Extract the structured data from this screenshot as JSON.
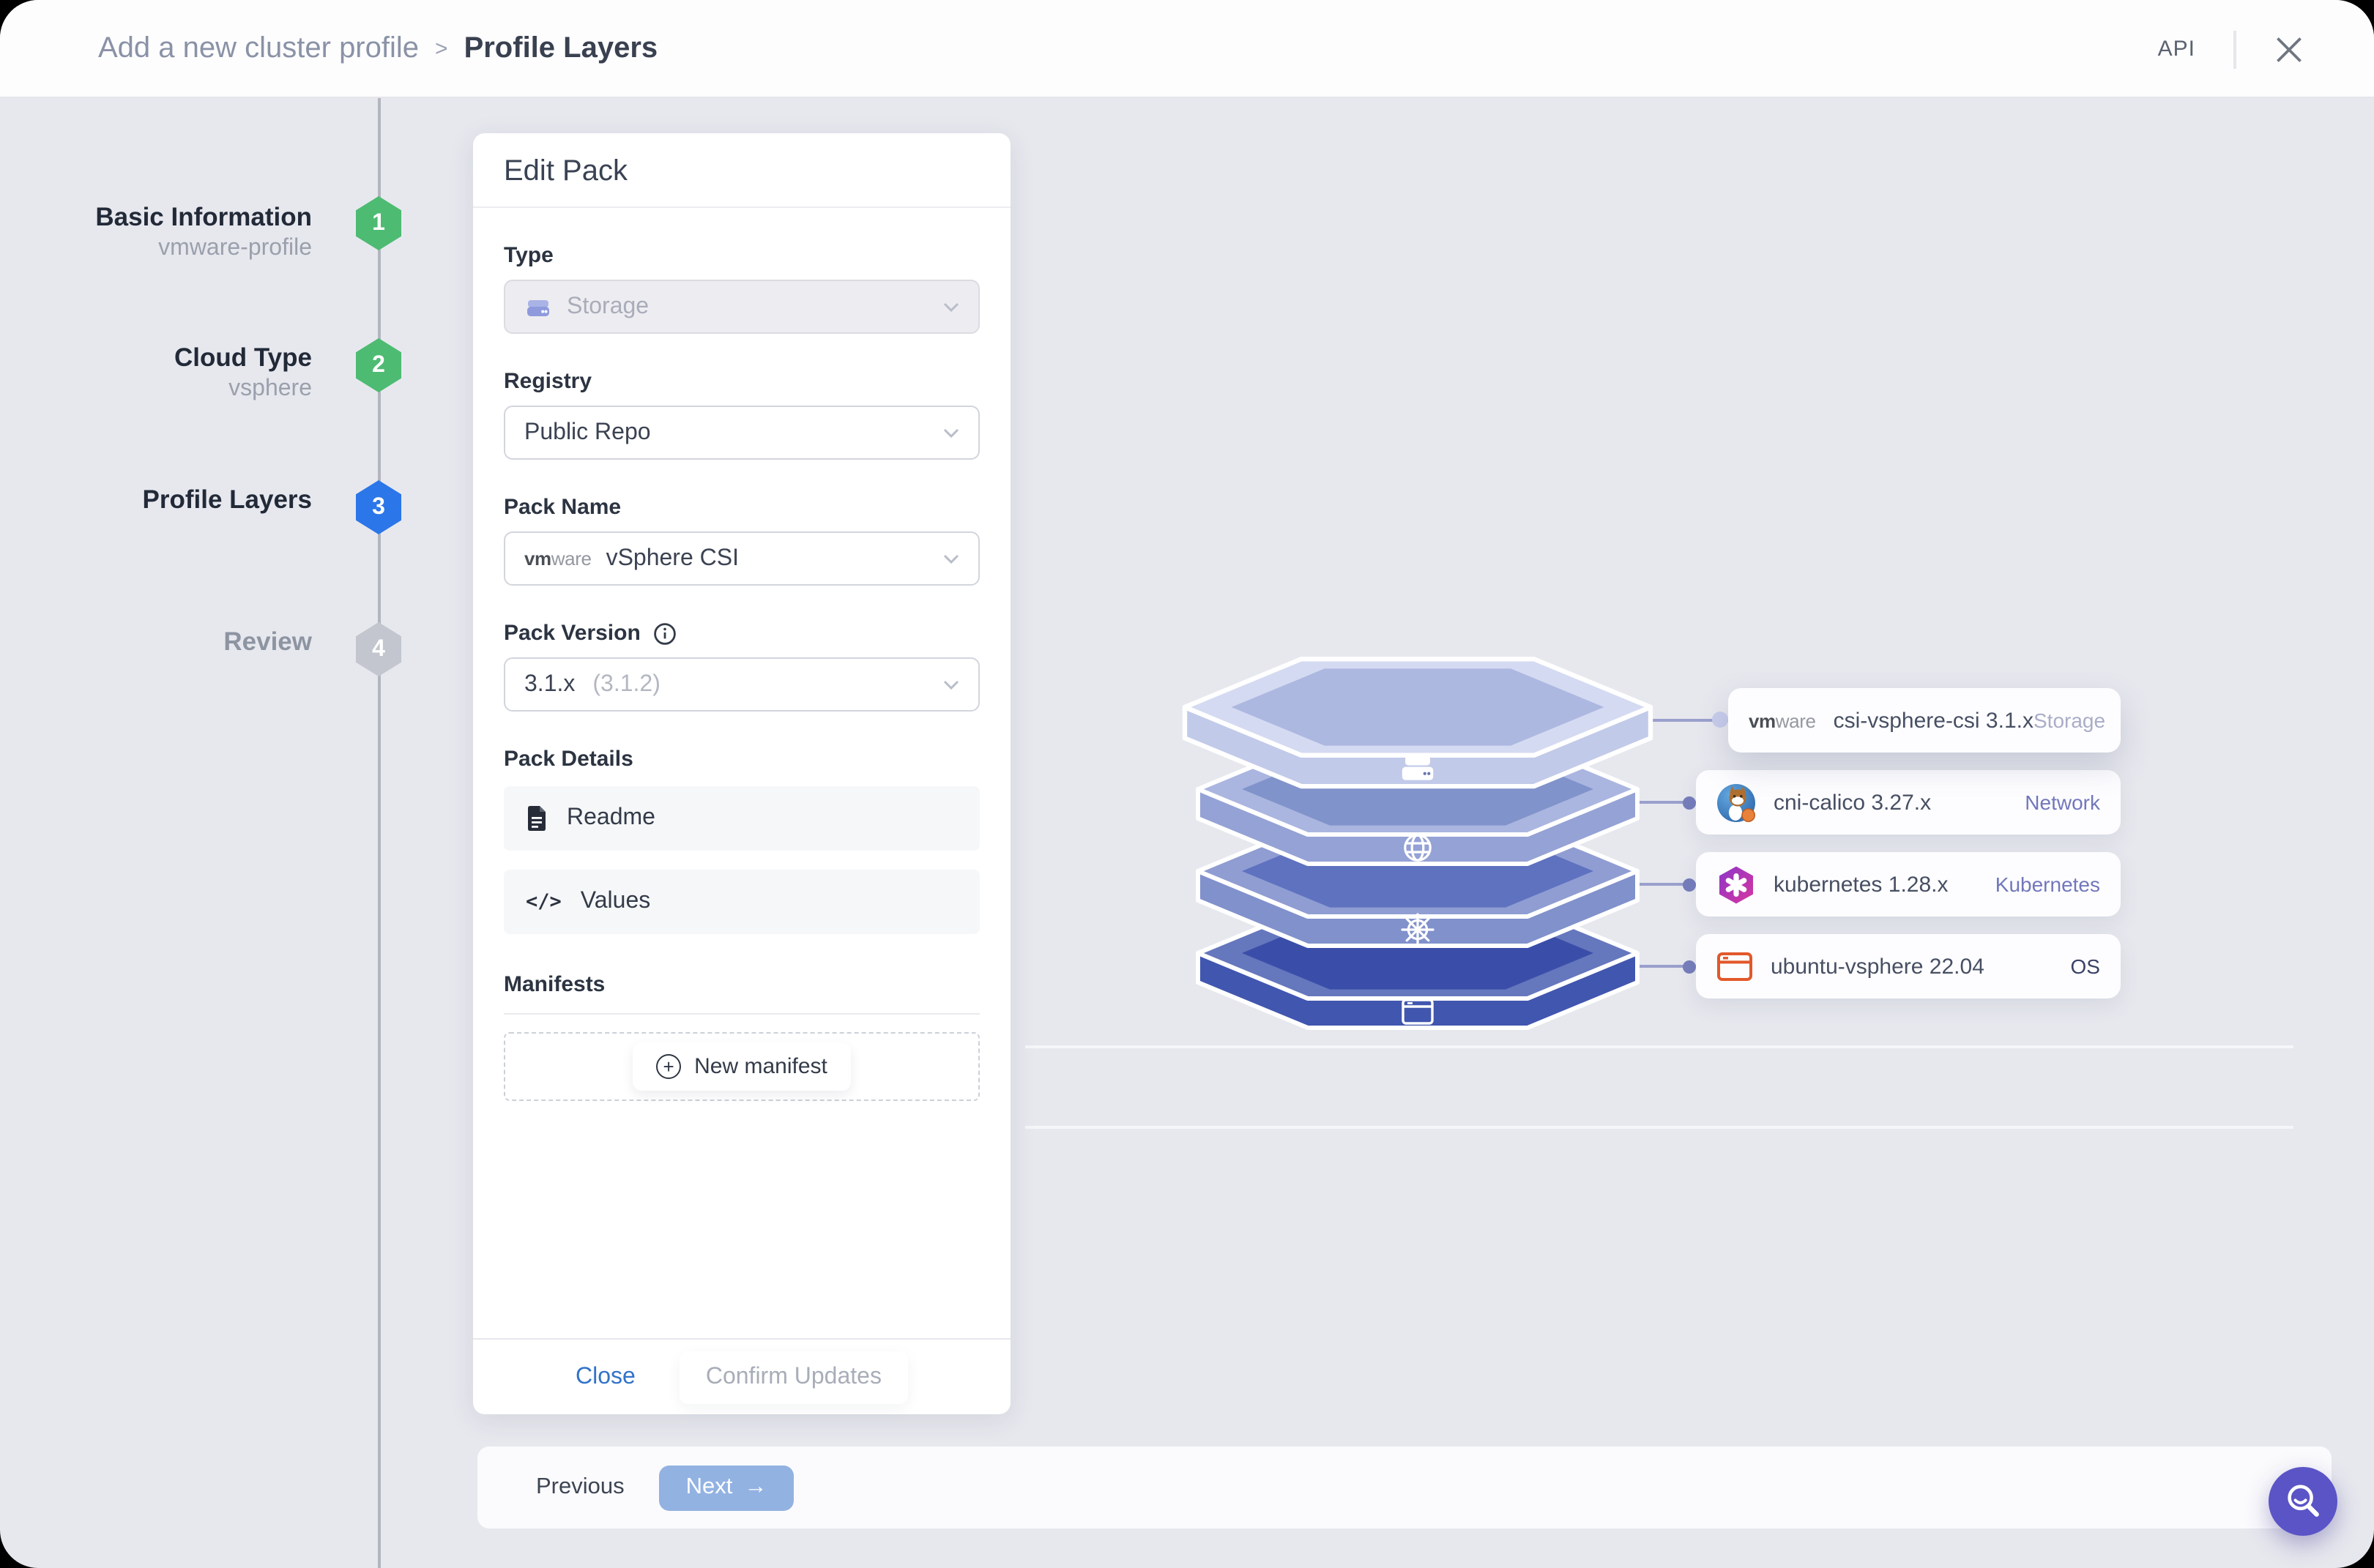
{
  "header": {
    "breadcrumb_parent": "Add a new cluster profile",
    "breadcrumb_separator": ">",
    "breadcrumb_current": "Profile Layers",
    "api_label": "API"
  },
  "stepper": {
    "steps": [
      {
        "number": "1",
        "title": "Basic Information",
        "subtitle": "vmware-profile",
        "state": "done"
      },
      {
        "number": "2",
        "title": "Cloud Type",
        "subtitle": "vsphere",
        "state": "done"
      },
      {
        "number": "3",
        "title": "Profile Layers",
        "subtitle": "",
        "state": "active"
      },
      {
        "number": "4",
        "title": "Review",
        "subtitle": "",
        "state": "upcoming"
      }
    ]
  },
  "colors": {
    "step_done": "#4dbb72",
    "step_active": "#2b76e8",
    "step_upcoming": "#c3c6ce",
    "accent_blue": "#3273c9",
    "next_button": "#92b2e2",
    "fab_purple": "#5b54c6",
    "canvas_bg": "#e7e8ee"
  },
  "brand": {
    "vmware_bold": "vm",
    "vmware_light": "ware"
  },
  "edit_pack": {
    "title": "Edit Pack",
    "fields": {
      "type": {
        "label": "Type",
        "value": "Storage",
        "disabled": true
      },
      "registry": {
        "label": "Registry",
        "value": "Public Repo"
      },
      "pack_name": {
        "label": "Pack Name",
        "value": "vSphere CSI"
      },
      "pack_version": {
        "label": "Pack Version",
        "value": "3.1.x",
        "value_hint": "(3.1.2)"
      }
    },
    "pack_details": {
      "label": "Pack Details",
      "items": [
        {
          "label": "Readme",
          "icon": "document-icon"
        },
        {
          "label": "Values",
          "icon": "code-icon",
          "icon_glyph": "</>"
        }
      ]
    },
    "manifests": {
      "label": "Manifests",
      "new_manifest_label": "New manifest",
      "plus_glyph": "+"
    },
    "footer": {
      "close_label": "Close",
      "confirm_label": "Confirm Updates"
    }
  },
  "stack": {
    "layers": [
      {
        "name": "csi-vsphere-csi 3.1.x",
        "category": "Storage",
        "icon": "storage-drive-icon",
        "logo": "vmware-wordmark",
        "rim": "#d4daf1",
        "top": "#adb8e1",
        "band": "#c2cae9",
        "category_color": "#a9adc8"
      },
      {
        "name": "cni-calico 3.27.x",
        "category": "Network",
        "icon": "globe-icon",
        "logo": "calico-cat-logo",
        "rim": "#aab6e0",
        "top": "#8093ca",
        "band": "#95a2d5",
        "category_color": "#7277bb"
      },
      {
        "name": "kubernetes 1.28.x",
        "category": "Kubernetes",
        "icon": "helm-wheel-icon",
        "logo": "kubernetes-hexagon-logo",
        "rim": "#8f9dd2",
        "top": "#5e72c0",
        "band": "#8091cc",
        "category_color": "#7277bb"
      },
      {
        "name": "ubuntu-vsphere 22.04",
        "category": "OS",
        "icon": "window-icon",
        "logo": "ubuntu-window-logo",
        "rim": "#6577bd",
        "top": "#3a4ea9",
        "band": "#4156af",
        "category_color": "#3a4268"
      }
    ]
  },
  "footer_bar": {
    "previous_label": "Previous",
    "next_label": "Next",
    "next_arrow": "→"
  }
}
